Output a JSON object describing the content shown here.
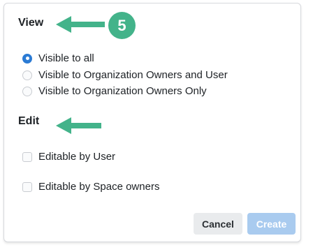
{
  "view_section": {
    "title": "View",
    "step_number": "5",
    "options": [
      {
        "label": "Visible to all",
        "selected": true
      },
      {
        "label": "Visible to Organization Owners and User",
        "selected": false
      },
      {
        "label": "Visible to Organization Owners Only",
        "selected": false
      }
    ]
  },
  "edit_section": {
    "title": "Edit",
    "options": [
      {
        "label": "Editable by User",
        "checked": false
      },
      {
        "label": "Editable by Space owners",
        "checked": false
      }
    ]
  },
  "actions": {
    "cancel_label": "Cancel",
    "create_label": "Create"
  },
  "colors": {
    "accent_green": "#43b38a",
    "radio_selected": "#2b7bd4",
    "create_disabled": "#a9cbef"
  },
  "icons": {
    "annotation_arrow": "arrow-left-icon"
  }
}
